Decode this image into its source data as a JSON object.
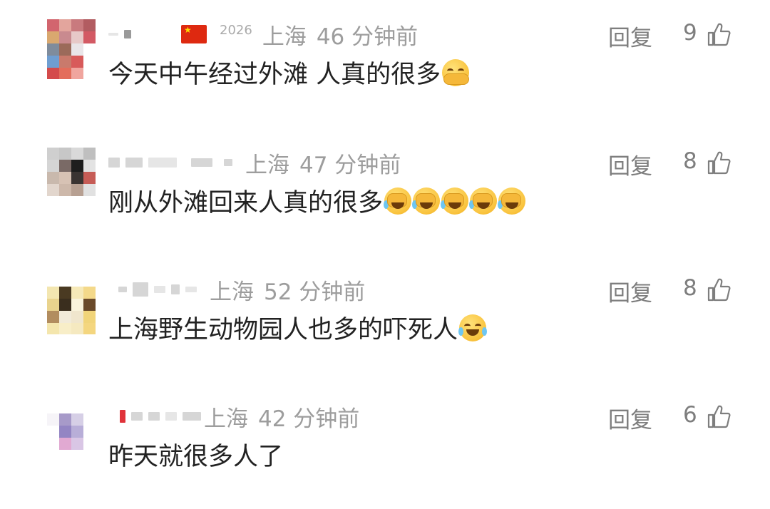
{
  "comments": [
    {
      "year": "2026",
      "location": "上海",
      "time": "46 分钟前",
      "text": "今天中午经过外滩 人真的很多",
      "emojis": [
        "shushing-face-emoji"
      ],
      "reply_label": "回复",
      "likes": "9"
    },
    {
      "location": "上海",
      "time": "47 分钟前",
      "text": "刚从外滩回来人真的很多",
      "emojis": [
        "face-palm-emoji",
        "face-palm-emoji",
        "face-palm-emoji",
        "face-palm-emoji",
        "face-palm-emoji"
      ],
      "reply_label": "回复",
      "likes": "8"
    },
    {
      "location": "上海",
      "time": "52 分钟前",
      "text": "上海野生动物园人也多的吓死人",
      "emojis": [
        "tears-of-joy-emoji"
      ],
      "reply_label": "回复",
      "likes": "8"
    },
    {
      "location": "上海",
      "time": "42 分钟前",
      "text": "昨天就很多人了",
      "emojis": [],
      "reply_label": "回复",
      "likes": "6"
    }
  ],
  "icons": {
    "like": "thumbs-up-icon",
    "flag": "china-flag-icon"
  },
  "colors": {
    "meta_text": "#9d9d9d",
    "body_text": "#222222",
    "action_text": "#7e7e7e",
    "flag_red": "#de2910",
    "flag_star": "#ffde00"
  }
}
